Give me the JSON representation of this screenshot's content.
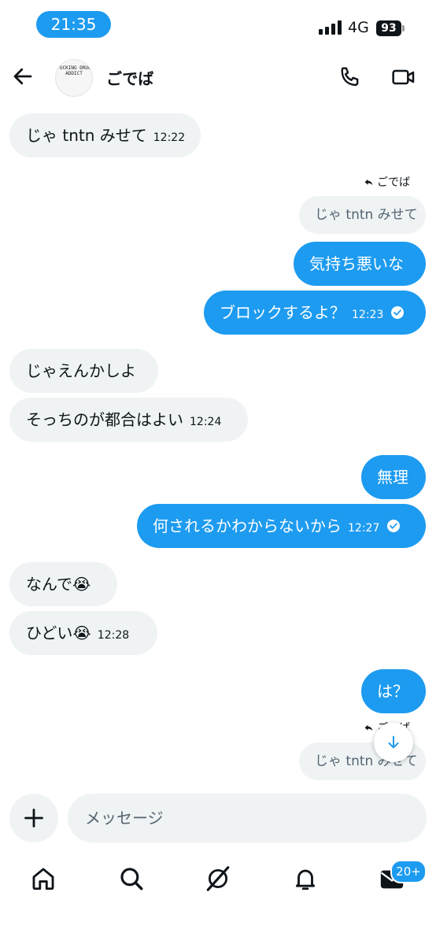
{
  "status_bar": {
    "time": "21:35",
    "network": "4G",
    "battery": "93"
  },
  "header": {
    "avatar_text": "FUCKING DRUG ADDICT",
    "contact_name": "ごでば"
  },
  "messages": [
    {
      "side": "received",
      "text": "じゃ tntn みせて",
      "time": "12:22"
    },
    {
      "side": "sent",
      "reply_to_user": "ごでば",
      "quoted_text": "じゃ tntn みせて"
    },
    {
      "side": "sent",
      "text": "気持ち悪いな"
    },
    {
      "side": "sent",
      "text": "ブロックするよ？",
      "time": "12:23"
    },
    {
      "side": "received",
      "text": "じゃえんかしよ"
    },
    {
      "side": "received",
      "text": "そっちのが都合はよい",
      "time": "12:24"
    },
    {
      "side": "sent",
      "text": "無理"
    },
    {
      "side": "sent",
      "text": "何されるかわからないから",
      "time": "12:27"
    },
    {
      "side": "received",
      "text": "なんで😭"
    },
    {
      "side": "received",
      "text": "ひどい😭",
      "time": "12:28"
    },
    {
      "side": "sent",
      "text": "は？"
    },
    {
      "side": "sent",
      "reply_to_user": "ごでば",
      "quoted_text": "じゃ tntn みせて"
    }
  ],
  "composer": {
    "placeholder": "メッセージ"
  },
  "nav": {
    "messages_badge": "20+"
  },
  "colors": {
    "accent": "#1d9bf0",
    "received_bubble": "#eff3f4",
    "text": "#0f1419"
  },
  "icons": [
    "back-arrow-icon",
    "phone-icon",
    "video-icon",
    "reply-icon",
    "check-icon",
    "arrow-down-icon",
    "plus-icon",
    "home-icon",
    "search-icon",
    "grok-icon",
    "bell-icon",
    "mail-icon"
  ]
}
